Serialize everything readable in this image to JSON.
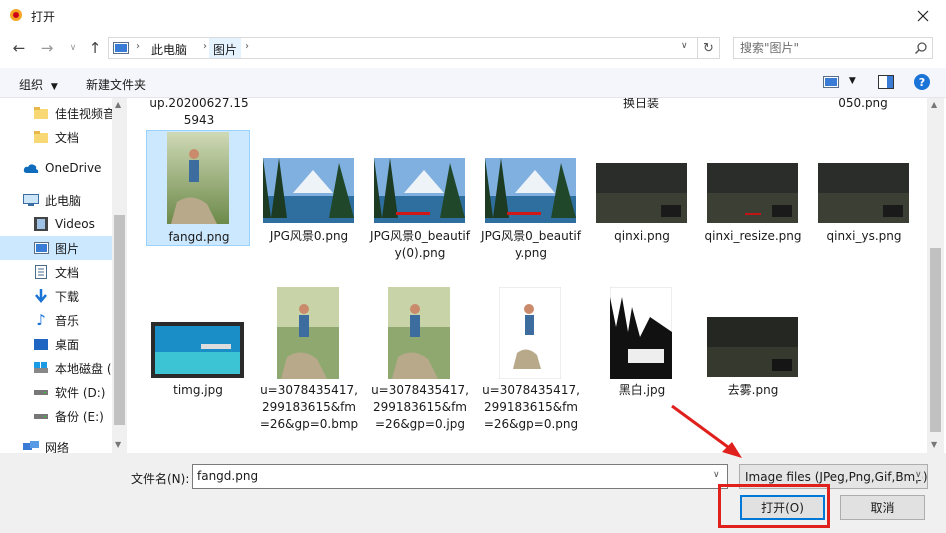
{
  "window": {
    "title": "打开"
  },
  "navigation": {
    "back_icon": "arrow-left-icon",
    "breadcrumb": [
      "此电脑",
      "图片"
    ],
    "search": {
      "placeholder": "搜索\"图片\""
    }
  },
  "toolbar": {
    "organize_label": "组织",
    "new_folder_label": "新建文件夹",
    "help_label": "?"
  },
  "nav_pane": {
    "items": [
      {
        "label": "佳佳视频音",
        "icon": "folder-icon"
      },
      {
        "label": "文档",
        "icon": "folder-icon"
      },
      {
        "label": "OneDrive",
        "icon": "cloud-icon"
      },
      {
        "label": "此电脑",
        "icon": "computer-icon"
      },
      {
        "label": "Videos",
        "icon": "video-folder-icon"
      },
      {
        "label": "图片",
        "icon": "pictures-folder-icon",
        "selected": true
      },
      {
        "label": "文档",
        "icon": "documents-folder-icon"
      },
      {
        "label": "下载",
        "icon": "download-icon"
      },
      {
        "label": "音乐",
        "icon": "music-icon"
      },
      {
        "label": "桌面",
        "icon": "desktop-icon"
      },
      {
        "label": "本地磁盘 (",
        "icon": "drive-icon"
      },
      {
        "label": "软件 (D:)",
        "icon": "drive-icon"
      },
      {
        "label": "备份 (E:)",
        "icon": "drive-icon"
      },
      {
        "label": "网络",
        "icon": "network-icon"
      }
    ]
  },
  "files": {
    "partial_top": [
      "up.20200627.15",
      "5943",
      "换日装",
      "050.png"
    ],
    "row1": [
      {
        "name": "fangd.png",
        "selected": true
      },
      {
        "name": "JPG风景0.png"
      },
      {
        "name": "JPG风景0_beautify(0).png"
      },
      {
        "name": "JPG风景0_beautify.png"
      },
      {
        "name": "qinxi.png"
      },
      {
        "name": "qinxi_resize.png"
      },
      {
        "name": "qinxi_ys.png"
      }
    ],
    "row2": [
      {
        "name": "timg.jpg"
      },
      {
        "name": "u=3078435417,299183615&fm=26&gp=0.bmp"
      },
      {
        "name": "u=3078435417,299183615&fm=26&gp=0.jpg"
      },
      {
        "name": "u=3078435417,299183615&fm=26&gp=0.png"
      },
      {
        "name": "黑白.jpg"
      },
      {
        "name": "去雾.png"
      }
    ]
  },
  "bottom": {
    "filename_label": "文件名(N):",
    "filename_value": "fangd.png",
    "filetype_value": "Image files (JPeg,Png,Gif,Bmp)",
    "open_label": "打开(O)",
    "cancel_label": "取消"
  },
  "colors": {
    "selection": "#cce8ff",
    "accent": "#0078d7",
    "annotation_red": "#e0201c"
  }
}
